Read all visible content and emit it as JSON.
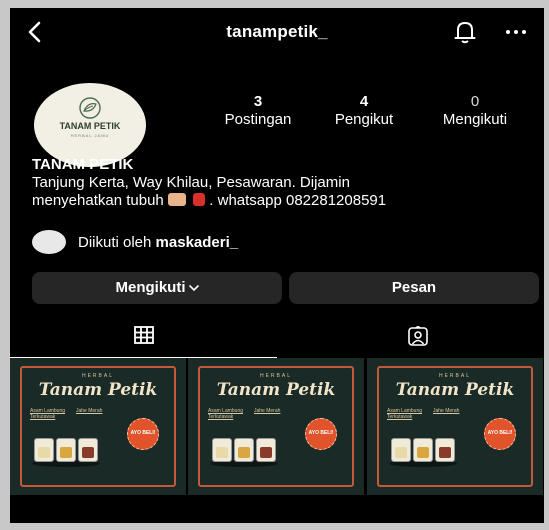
{
  "header": {
    "username": "tanampetik_",
    "back_icon": "chevron-left-icon",
    "notification_icon": "bell-icon",
    "more_icon": "more-horizontal-icon"
  },
  "profile": {
    "avatar_brand": "TANAM PETIK",
    "avatar_subtitle": "HERBAL JAMU",
    "stats": [
      {
        "value": "3",
        "label": "Postingan"
      },
      {
        "value": "4",
        "label": "Pengikut"
      },
      {
        "value": "0",
        "label": "Mengikuti"
      }
    ],
    "display_name": "TANAM PETIK",
    "bio_line1": "Tanjung Kerta, Way Khilau, Pesawaran. Dijamin",
    "bio_line2_part1": "menyehatkan tubuh",
    "bio_line2_part2": ". whatsapp 082281208591",
    "followed_by_prefix": "Diikuti oleh ",
    "followed_by_user": "maskaderi_"
  },
  "actions": {
    "following_label": "Mengikuti",
    "message_label": "Pesan"
  },
  "tabs": {
    "posts_icon": "grid-icon",
    "tagged_icon": "tagged-person-icon"
  },
  "posts": [
    {
      "tag": "HERBAL",
      "title": "Tanam Petik",
      "line1": "Asam Lambung",
      "line2": "Terkutawak",
      "line3": "Jahe Merah",
      "badge": "AYO BELI!"
    },
    {
      "tag": "HERBAL",
      "title": "Tanam Petik",
      "line1": "Asam Lambung",
      "line2": "Terkutawak",
      "line3": "Jahe Merah",
      "badge": "AYO BELI!"
    },
    {
      "tag": "HERBAL",
      "title": "Tanam Petik",
      "line1": "Asam Lambung",
      "line2": "Terkutawak",
      "line3": "Jahe Merah",
      "badge": "AYO BELI!"
    }
  ],
  "colors": {
    "background": "#000000",
    "button": "#262626",
    "post_bg": "#1a2a27",
    "post_border": "#c25a3c",
    "badge": "#e0532b"
  }
}
